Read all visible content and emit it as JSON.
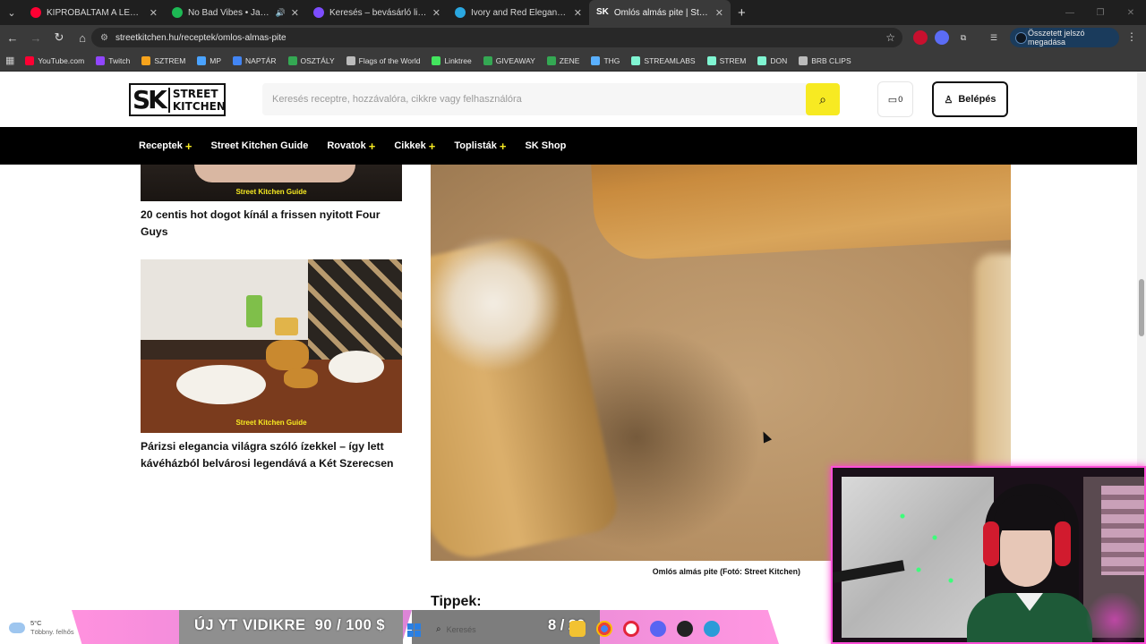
{
  "browser": {
    "tabs": [
      {
        "title": "KIPRÓBÁLTAM A LEGENDÁS KÁ",
        "color": "#ff0033"
      },
      {
        "title": "No Bad Vibes • Jazzy, KILIM",
        "color": "#1db954"
      },
      {
        "title": "Keresés – bevásárló lista – Canv",
        "color": "#7d4dff"
      },
      {
        "title": "Ivory and Red Elegant Minimali",
        "color": "#2aa7e0"
      },
      {
        "title": "Omlós almás pite | Street Kitche",
        "color": "#ffffff",
        "fav_text": "SK"
      }
    ],
    "url": "streetkitchen.hu/receptek/omlos-almas-pite",
    "password_prompt": "Összetett jelszó megadása",
    "bookmarks": [
      {
        "label": "YouTube.com",
        "color": "#ff0033"
      },
      {
        "label": "Twitch",
        "color": "#9146ff"
      },
      {
        "label": "SZTREM",
        "color": "#f7a31c"
      },
      {
        "label": "MP",
        "color": "#4aa3ff"
      },
      {
        "label": "NAPTÁR",
        "color": "#4285f4"
      },
      {
        "label": "OSZTÁLY",
        "color": "#34a853"
      },
      {
        "label": "Flags of the World",
        "color": "#bbbbbb"
      },
      {
        "label": "Linktree",
        "color": "#43e55e"
      },
      {
        "label": "GIVEAWAY",
        "color": "#34a853"
      },
      {
        "label": "ZENE",
        "color": "#34a853"
      },
      {
        "label": "THG",
        "color": "#5ab0ff"
      },
      {
        "label": "STREAMLABS",
        "color": "#80f5d2"
      },
      {
        "label": "STREM",
        "color": "#80f5d2"
      },
      {
        "label": "DON",
        "color": "#80f5d2"
      },
      {
        "label": "BRB CLIPS",
        "color": "#bbbbbb"
      }
    ]
  },
  "site": {
    "logo_sk": "SK",
    "logo_line1": "STREET",
    "logo_line2": "KITCHEN",
    "search_placeholder": "Keresés receptre, hozzávalóra, cikkre vagy felhasználóra",
    "cart_count": "0",
    "login_label": "Belépés",
    "nav": [
      {
        "label": "Receptek",
        "plus": true
      },
      {
        "label": "Street Kitchen Guide",
        "plus": false
      },
      {
        "label": "Rovatok",
        "plus": true
      },
      {
        "label": "Cikkek",
        "plus": true
      },
      {
        "label": "Toplisták",
        "plus": true
      },
      {
        "label": "SK Shop",
        "plus": false
      }
    ]
  },
  "sidebar": {
    "card1": {
      "badge": "Street Kitchen Guide",
      "title": "20 centis hot dogot kínál a frissen nyitott Four Guys"
    },
    "card2": {
      "badge": "Street Kitchen Guide",
      "title": "Párizsi elegancia világra szóló ízekkel – így lett kávéházból belvárosi legendává a Két Szerecsen"
    }
  },
  "article": {
    "image_caption": "Omlós almás pite (Fotó: Street Kitchen)",
    "section_heading": "Tippek:"
  },
  "overlay": {
    "goal_text": "ÚJ YT VIDIKRE",
    "goal_progress": "90 / 100 $",
    "counter": "8 / 20"
  },
  "taskbar": {
    "temperature": "5°C",
    "weather": "Többny. felhős",
    "search_label": "Keresés"
  }
}
